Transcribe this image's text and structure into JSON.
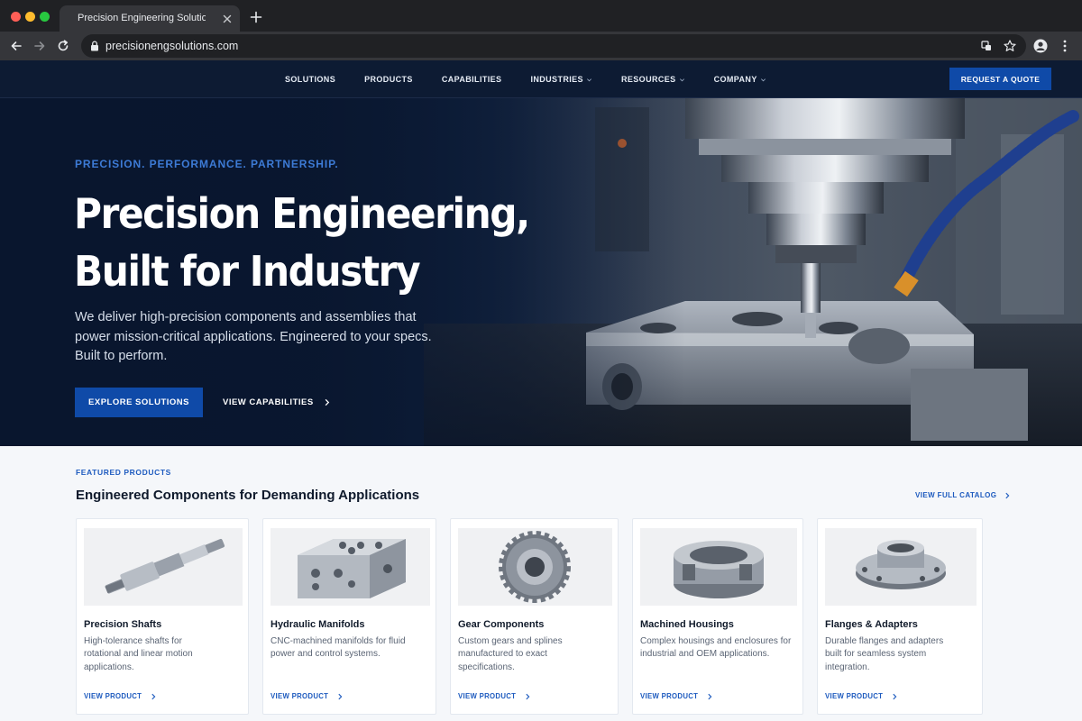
{
  "browser": {
    "tab_title": "Precision Engineering Solutions",
    "url": "precisionengsolutions.com"
  },
  "header": {
    "nav": [
      {
        "label": "SOLUTIONS",
        "dropdown": false
      },
      {
        "label": "PRODUCTS",
        "dropdown": false
      },
      {
        "label": "CAPABILITIES",
        "dropdown": false
      },
      {
        "label": "INDUSTRIES",
        "dropdown": true
      },
      {
        "label": "RESOURCES",
        "dropdown": true
      },
      {
        "label": "COMPANY",
        "dropdown": true
      }
    ],
    "cta": "REQUEST A QUOTE"
  },
  "hero": {
    "eyebrow": "PRECISION. PERFORMANCE. PARTNERSHIP.",
    "title_line1": "Precision Engineering,",
    "title_line2": "Built for Industry",
    "description": "We deliver high-precision components and assemblies that power mission-critical applications. Engineered to your specs. Built to perform.",
    "primary_cta": "EXPLORE SOLUTIONS",
    "secondary_cta": "VIEW CAPABILITIES"
  },
  "featured": {
    "eyebrow": "FEATURED PRODUCTS",
    "title": "Engineered Components for Demanding Applications",
    "catalog_link": "VIEW FULL CATALOG",
    "products": [
      {
        "title": "Precision Shafts",
        "description": "High-tolerance shafts for rotational and linear motion applications.",
        "link": "VIEW PRODUCT"
      },
      {
        "title": "Hydraulic Manifolds",
        "description": "CNC-machined manifolds for fluid power and control systems.",
        "link": "VIEW PRODUCT"
      },
      {
        "title": "Gear Components",
        "description": "Custom gears and splines manufactured to exact specifications.",
        "link": "VIEW PRODUCT"
      },
      {
        "title": "Machined Housings",
        "description": "Complex housings and enclosures for industrial and OEM applications.",
        "link": "VIEW PRODUCT"
      },
      {
        "title": "Flanges & Adapters",
        "description": "Durable flanges and adapters built for seamless system integration.",
        "link": "VIEW PRODUCT"
      }
    ]
  },
  "colors": {
    "navy": "#0d1b33",
    "accent_blue": "#0f4aa8",
    "link_blue": "#1e5bbf"
  }
}
